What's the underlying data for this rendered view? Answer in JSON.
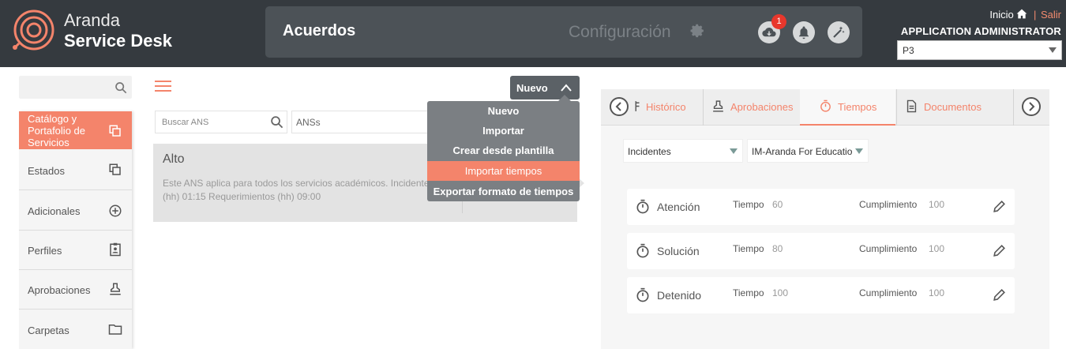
{
  "header": {
    "brand_line1": "Aranda",
    "brand_line2": "Service Desk",
    "module_title": "Acuerdos",
    "config_label": "Configuración",
    "notifications_count": "1",
    "inicio_label": "Inicio",
    "salir_label": "Salir",
    "separator": "|",
    "user_role": "APPLICATION ADMINISTRATOR",
    "project_selected": "P3"
  },
  "sidebar": {
    "search_placeholder": "",
    "items": [
      {
        "label": "Catálogo y Portafolio de Servicios",
        "icon": "copy-icon",
        "active": true
      },
      {
        "label": "Estados",
        "icon": "copy-icon"
      },
      {
        "label": "Adicionales",
        "icon": "plus-circle-icon"
      },
      {
        "label": "Perfiles",
        "icon": "clipboard-user-icon"
      },
      {
        "label": "Aprobaciones",
        "icon": "stamp-icon"
      },
      {
        "label": "Carpetas",
        "icon": "folder-icon"
      }
    ]
  },
  "main": {
    "nuevo_button": "Nuevo",
    "search_placeholder": "Buscar ANS",
    "filter_value": "ANSs",
    "menu": {
      "items": [
        "Nuevo",
        "Importar",
        "Crear desde plantilla",
        "Importar tiempos",
        "Exportar formato de tiempos"
      ],
      "highlighted": "Importar tiempos"
    },
    "card": {
      "title": "Alto",
      "description": "Este ANS aplica para todos los servicios académicos. Incidentes (hh) 01:15 Requerimientos (hh) 09:00"
    }
  },
  "right": {
    "tabs": [
      {
        "label": "Histórico",
        "icon": "history-icon"
      },
      {
        "label": "Aprobaciones",
        "icon": "stamp-icon"
      },
      {
        "label": "Tiempos",
        "icon": "stopwatch-icon",
        "active": true
      },
      {
        "label": "Documentos",
        "icon": "document-icon"
      }
    ],
    "type_select": "Incidentes",
    "model_select": "IM-Aranda For Education",
    "time_label": "Tiempo",
    "compliance_label": "Cumplimiento",
    "rows": [
      {
        "name": "Atención",
        "time": "60",
        "compliance": "100"
      },
      {
        "name": "Solución",
        "time": "80",
        "compliance": "100"
      },
      {
        "name": "Detenido",
        "time": "100",
        "compliance": "100"
      }
    ]
  },
  "colors": {
    "accent": "#f4846b",
    "header_bg": "#353a3f",
    "badge": "#e8372c"
  }
}
